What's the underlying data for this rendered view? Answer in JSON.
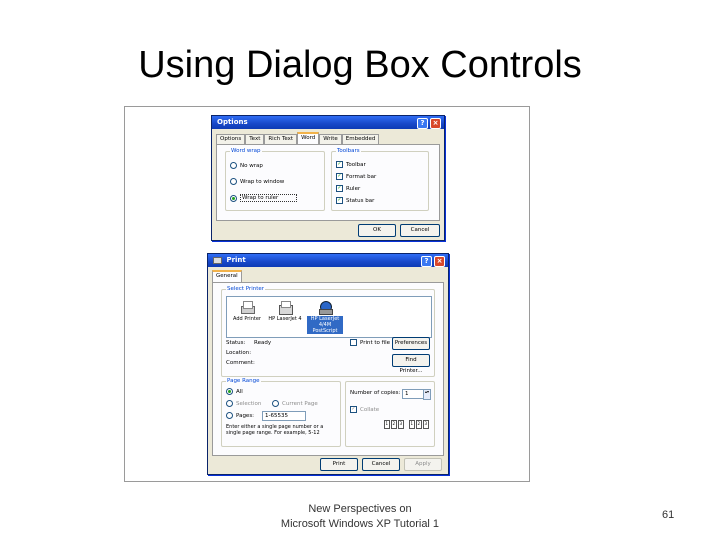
{
  "slide": {
    "title": "Using Dialog Box Controls",
    "footer_line1": "New Perspectives on",
    "footer_line2": "Microsoft Windows XP Tutorial 1",
    "page_number": "61"
  },
  "options_dialog": {
    "title": "Options",
    "tabs": [
      "Options",
      "Text",
      "Rich Text",
      "Word",
      "Write",
      "Embedded"
    ],
    "active_tab": "Word",
    "word_wrap": {
      "label": "Word wrap",
      "options": [
        "No wrap",
        "Wrap to window",
        "Wrap to ruler"
      ],
      "selected": "Wrap to ruler"
    },
    "toolbars": {
      "label": "Toolbars",
      "items": [
        "Toolbar",
        "Format bar",
        "Ruler",
        "Status bar"
      ],
      "checked": [
        true,
        true,
        true,
        true
      ]
    },
    "ok_label": "OK",
    "cancel_label": "Cancel"
  },
  "print_dialog": {
    "title": "Print",
    "tab": "General",
    "select_printer_label": "Select Printer",
    "printers": [
      "Add Printer",
      "HP LaserJet 4",
      "HP LaserJet 4/4M PostScript"
    ],
    "status_label": "Status:",
    "status_value": "Ready",
    "location_label": "Location:",
    "comment_label": "Comment:",
    "print_to_file_label": "Print to file",
    "preferences_label": "Preferences",
    "find_printer_label": "Find Printer...",
    "page_range_label": "Page Range",
    "range_all": "All",
    "range_selection": "Selection",
    "range_current": "Current Page",
    "range_pages": "Pages:",
    "pages_value": "1-65535",
    "range_help": "Enter either a single page number or a single page range.  For example, 5-12",
    "copies_label": "Number of copies:",
    "copies_value": "1",
    "collate_label": "Collate",
    "print_label": "Print",
    "cancel_label": "Cancel",
    "apply_label": "Apply"
  }
}
